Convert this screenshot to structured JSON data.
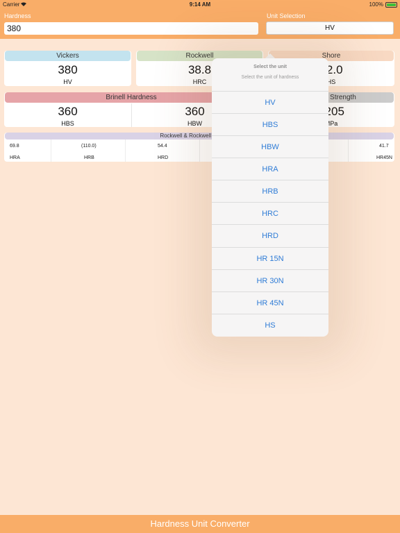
{
  "status_bar": {
    "carrier": "Carrier",
    "time": "9:14 AM",
    "battery": "100%"
  },
  "header": {
    "hardness_label": "Hardness",
    "hardness_value": "380",
    "unit_label": "Unit Selection",
    "unit_value": "HV"
  },
  "cards": {
    "vickers": {
      "title": "Vickers",
      "value": "380",
      "unit": "HV",
      "color": "#c3e3ef"
    },
    "rockwell": {
      "title": "Rockwell",
      "value": "38.8",
      "unit": "HRC",
      "color": "#d6e3c7"
    },
    "shore": {
      "title": "Shore",
      "value": "52.0",
      "unit": "HS",
      "color": "#f8d9c3"
    },
    "brinell": {
      "title": "Brinell Hardness",
      "left_value": "360",
      "left_unit": "HBS",
      "right_value": "360",
      "right_unit": "HBW",
      "color": "#e6a4a8"
    },
    "tensile": {
      "title": "Tensile Strength",
      "value": "1205",
      "unit": "MPa",
      "color": "#cccccc"
    }
  },
  "rockwell_strip": {
    "title": "Rockwell & Rockwell Superficial",
    "color": "#d9d2e6",
    "columns": [
      {
        "value": "69.8",
        "unit": "HRA"
      },
      {
        "value": "(110.0)",
        "unit": "HRB"
      },
      {
        "value": "54.4",
        "unit": "HRD"
      },
      {
        "value": "",
        "unit": ""
      },
      {
        "value": "",
        "unit": ""
      },
      {
        "value": "41.7",
        "unit": "HR45N"
      }
    ]
  },
  "popover": {
    "title": "Select the unit",
    "message": "Select the unit of hardness",
    "options": [
      "HV",
      "HBS",
      "HBW",
      "HRA",
      "HRB",
      "HRC",
      "HRD",
      "HR 15N",
      "HR 30N",
      "HR 45N",
      "HS"
    ]
  },
  "footer": {
    "title": "Hardness Unit Converter"
  },
  "colors": {
    "accent": "#f9ad68",
    "background": "#fde6d4",
    "link": "#2f7cd6"
  }
}
